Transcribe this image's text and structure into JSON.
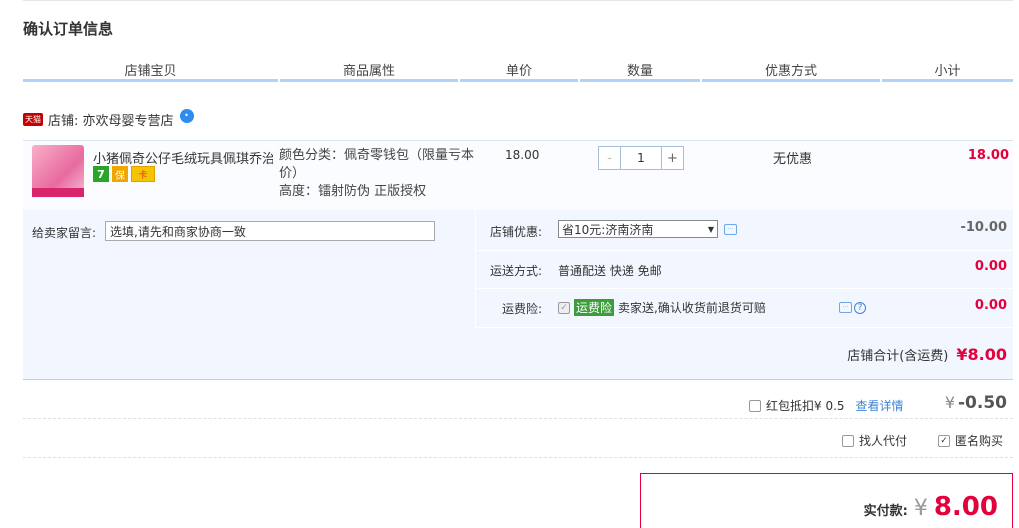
{
  "page_title": "确认订单信息",
  "columns": [
    "店铺宝贝",
    "商品属性",
    "单价",
    "数量",
    "优惠方式",
    "小计"
  ],
  "shop": {
    "badge": "天猫",
    "label": "店铺: 亦欢母婴专营店",
    "chat_icon": "wangwang-chat-icon"
  },
  "item": {
    "name": "小猪佩奇公仔毛绒玩具佩琪乔治...",
    "attr_color_line1": "颜色分类：佩奇零钱包（限量亏本",
    "attr_color_line2": "价）",
    "attr_height": "高度：镭射防伪 正版授权",
    "badge_7": "7",
    "badge_shield": "保",
    "badge_card": "卡",
    "price": "18.00",
    "quantity": "1",
    "minus": "-",
    "plus": "+",
    "discount": "无优惠",
    "subtotal": "18.00"
  },
  "memo": {
    "label": "给卖家留言:",
    "placeholder": "选填,请先和商家协商一致"
  },
  "shop_discount": {
    "label": "店铺优惠:",
    "selected": "省10元:济南济南",
    "amount": "-10.00"
  },
  "shipping": {
    "label": "运送方式:",
    "value": "普通配送 快递 免邮",
    "amount": "0.00"
  },
  "insurance": {
    "label": "运费险:",
    "badge": "运费险",
    "desc": "卖家送,确认收货前退货可赔",
    "amount": "0.00"
  },
  "shop_total": {
    "label": "店铺合计(含运费)",
    "value": "¥8.00"
  },
  "redpacket": {
    "label": "红包抵扣¥ 0.5",
    "link": "查看详情",
    "yen": "¥",
    "amount": "-0.50"
  },
  "options": {
    "proxy_pay": "找人代付",
    "anonymous": "匿名购买"
  },
  "final": {
    "label": "实付款:",
    "yen": "¥",
    "amount": "8.00"
  },
  "colors": {
    "accent_red": "#e4003a",
    "header_underline": "#b2d1ff",
    "panel_bg": "#f2f7ff"
  }
}
